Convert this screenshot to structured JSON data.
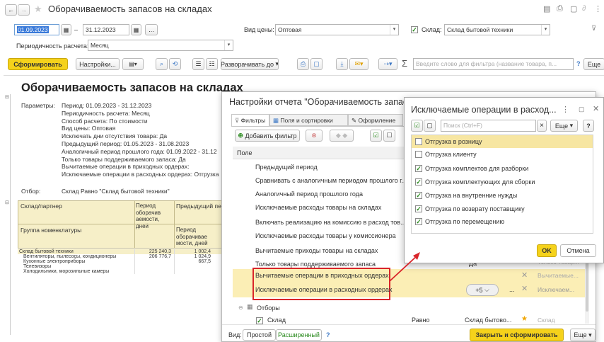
{
  "window": {
    "title": "Оборачиваемость запасов на складах"
  },
  "filters": {
    "date_from": "01.09.2023",
    "date_dash": "–",
    "date_to": "31.12.2023",
    "more": "...",
    "price_label": "Вид цены:",
    "price_value": "Оптовая",
    "warehouse_label": "Склад:",
    "warehouse_value": "Склад бытовой техники",
    "period_label": "Периодичность расчета:",
    "period_value": "Месяц"
  },
  "toolbar": {
    "form_label": "Сформировать",
    "settings_label": "Настройки...",
    "expand_label": "Разворачивать до",
    "search_placeholder": "Введите слово для фильтра (название товара, п...",
    "help": "?",
    "more": "Еще"
  },
  "report": {
    "title": "Оборачиваемость запасов на складах",
    "params_label": "Параметры:",
    "params": [
      "Период: 01.09.2023 - 31.12.2023",
      "Периодичность расчета: Месяц",
      "Способ расчета: По стоимости",
      "Вид цены: Оптовая",
      "Исключать дни отсутствия товара: Да",
      "Предыдущий период: 01.05.2023 - 31.08.2023",
      "Аналогичный период прошлого года: 01.09.2022 - 31.12",
      "Только товары поддерживаемого запаса: Да",
      "Вычитаемые операции в приходных ордерах:",
      "Исключаемые операции в расходных ордерах: Отгрузка"
    ],
    "filter_label": "Отбор:",
    "filter_value": "Склад Равно \"Склад бытовой техники\"",
    "table": {
      "h_partner": "Склад/партнер",
      "h_group": "Группа номенклатуры",
      "h_period": "Период оборачив аемости, дней",
      "h_prev": "Предыдущий пе",
      "h_prev_sub": "Период оборачивае мости, дней",
      "rows": [
        {
          "name": "Склад бытовой техники",
          "v1": "225 240,3",
          "v2": "1 002,4"
        },
        {
          "name": "Вентиляторы, пылесосы, кондиционеры",
          "v1": "206 776,7",
          "v2": "1 024,9"
        },
        {
          "name": "Кухонные электроприборы",
          "v1": "",
          "v2": "667,5"
        },
        {
          "name": "Телевизоры",
          "v1": "",
          "v2": ""
        },
        {
          "name": "Холодильники, морозильные камеры",
          "v1": "",
          "v2": ""
        }
      ]
    }
  },
  "settings": {
    "title": "Настройки отчета \"Оборачиваемость запасо",
    "tabs": [
      "Фильтры",
      "Поля и сортировки",
      "Оформление"
    ],
    "add_filter": "Добавить фильтр",
    "col_field": "Поле",
    "rows": [
      "Предыдущий период",
      "Сравнивать с аналогичным периодом прошлого г...",
      "Аналогичный период прошлого года",
      "Исключаемые расходы товары на складах",
      "Включать реализацию на комиссию в расход тов...",
      "Исключаемые расходы товары у комиссионера",
      "Вычитаемые приходы товары на складах",
      "Только товары поддерживаемого запаса",
      "Вычитаемые операции в приходных ордерах",
      "Исключаемые операции в расходных ордерах"
    ],
    "yes": "Да",
    "plus5": "+5",
    "ellipsis": "...",
    "side_values": [
      "Только товар...",
      "Вычитаемые...",
      "Исключаем..."
    ],
    "selections_label": "Отборы",
    "sel_field": "Склад",
    "sel_cond": "Равно",
    "sel_value": "Склад бытово...",
    "sel_side": "Склад",
    "view_label": "Вид:",
    "view_simple": "Простой",
    "view_extended": "Расширенный",
    "view_help": "?",
    "close_form": "Закрыть и сформировать",
    "more": "Еще"
  },
  "popup": {
    "title": "Исключаемые операции в расход...",
    "search_placeholder": "Поиск (Ctrl+F)",
    "search_clear": "×",
    "more": "Еще",
    "help": "?",
    "items": [
      {
        "label": "Отгрузка в розницу",
        "checked": false
      },
      {
        "label": "Отгрузка клиенту",
        "checked": false
      },
      {
        "label": "Отгрузка комплектов для разборки",
        "checked": true
      },
      {
        "label": "Отгрузка комплектующих для сборки",
        "checked": true
      },
      {
        "label": "Отгрузка на внутренние нужды",
        "checked": true
      },
      {
        "label": "Отгрузка по возврату поставщику",
        "checked": true
      },
      {
        "label": "Отгрузка по перемещению",
        "checked": true
      }
    ],
    "ok": "OK",
    "cancel": "Отмена"
  },
  "colors": {
    "accent_yellow": "#f5d21b",
    "highlight": "#fbeeb5",
    "annotation_red": "#d9252a",
    "check_green": "#2a8a1e"
  }
}
